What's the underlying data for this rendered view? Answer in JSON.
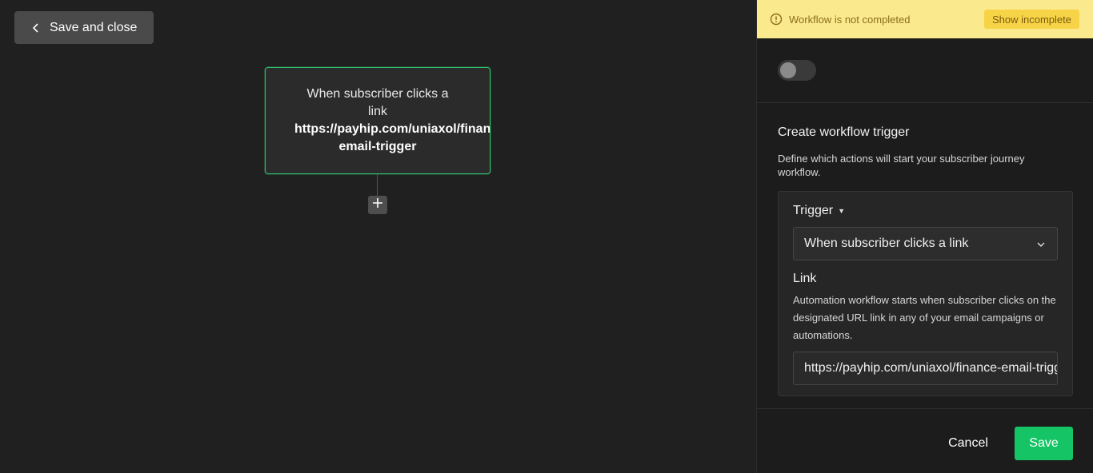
{
  "toolbar": {
    "back_label": "Save and close",
    "back_icon": "chevron-left-icon"
  },
  "node": {
    "line1": "When subscriber clicks a link",
    "url_part1": "https://payhip.com/uniaxol/finance-",
    "url_part2": "email-trigger"
  },
  "canvas": {
    "add_icon": "plus-icon"
  },
  "panel": {
    "warning": {
      "text": "Workflow is not completed",
      "button_label": "Show incomplete",
      "icon": "alert-circle-icon"
    },
    "toggle": {
      "on": false
    },
    "section_title": "Create workflow trigger",
    "section_desc": "Define which actions will start your subscriber journey workflow.",
    "trigger": {
      "label": "Trigger",
      "selected": "When subscriber clicks a link"
    },
    "link": {
      "label": "Link",
      "description": "Automation workflow starts when subscriber clicks on the designated URL link in any of your email campaigns or automations.",
      "value": "https://payhip.com/uniaxol/finance-email-trigger"
    },
    "actions": {
      "cancel": "Cancel",
      "save": "Save"
    }
  },
  "colors": {
    "accent_green": "#14c465",
    "node_border": "#2fbf6b",
    "warning_bg": "#fbe98d"
  }
}
